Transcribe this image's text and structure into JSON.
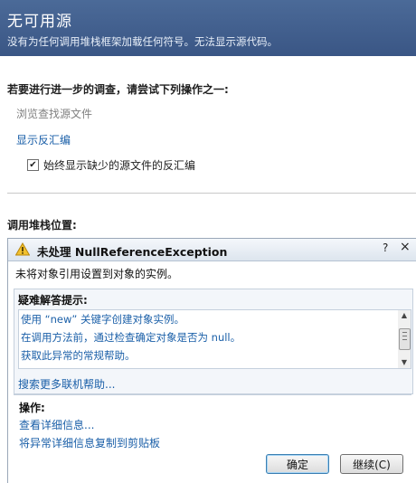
{
  "banner": {
    "title": "无可用源",
    "message": "没有为任何调用堆栈框架加载任何符号。无法显示源代码。"
  },
  "investigate": {
    "heading": "若要进行进一步的调查，请尝试下列操作之一:",
    "browse_label": "浏览查找源文件",
    "disassembly_link": "显示反汇编",
    "checkbox_label": "始终显示缺少的源文件的反汇编",
    "checkbox_checked": true
  },
  "call_stack": {
    "heading": "调用堆栈位置:"
  },
  "exception": {
    "title": "未处理 NullReferenceException",
    "help_btn": "?",
    "close_btn": "×",
    "message": "未将对象引用设置到对象的实例。",
    "hints_heading": "疑难解答提示:",
    "hints": [
      "使用 “new” 关键字创建对象实例。",
      "在调用方法前，通过检查确定对象是否为 null。",
      "获取此异常的常规帮助。"
    ],
    "search_link": "搜索更多联机帮助...",
    "actions_heading": "操作:",
    "actions": [
      "查看详细信息...",
      "将异常详细信息复制到剪贴板"
    ],
    "ok_button": "确定",
    "continue_button": "继续(C)"
  },
  "colors": {
    "banner_bg": "#3a5685",
    "link": "#1a5fa8",
    "warning": "#f2c12e"
  }
}
